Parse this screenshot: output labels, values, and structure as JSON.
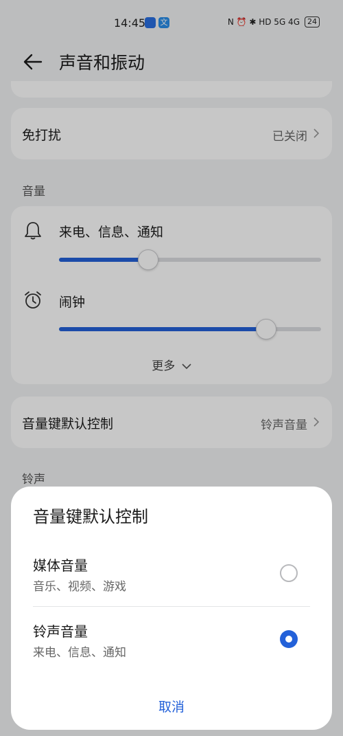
{
  "status_bar": {
    "time": "14:45",
    "icons_text": "N ⏰ ✱ HD 5G 4G",
    "battery": "24"
  },
  "header": {
    "title": "声音和振动"
  },
  "dnd": {
    "label": "免打扰",
    "value": "已关闭"
  },
  "volume_section": {
    "title": "音量",
    "items": [
      {
        "label": "来电、信息、通知",
        "icon": "bell-icon",
        "level": 0.34
      },
      {
        "label": "闹钟",
        "icon": "alarm-clock-icon",
        "level": 0.79
      }
    ],
    "more": "更多"
  },
  "volume_key": {
    "label": "音量键默认控制",
    "value": "铃声音量"
  },
  "ringtone_section": {
    "title": "铃声"
  },
  "sheet": {
    "title": "音量键默认控制",
    "options": [
      {
        "title": "媒体音量",
        "subtitle": "音乐、视频、游戏",
        "checked": false
      },
      {
        "title": "铃声音量",
        "subtitle": "来电、信息、通知",
        "checked": true
      }
    ],
    "cancel": "取消"
  },
  "colors": {
    "accent": "#2361d9",
    "background": "#f1f2f4"
  }
}
